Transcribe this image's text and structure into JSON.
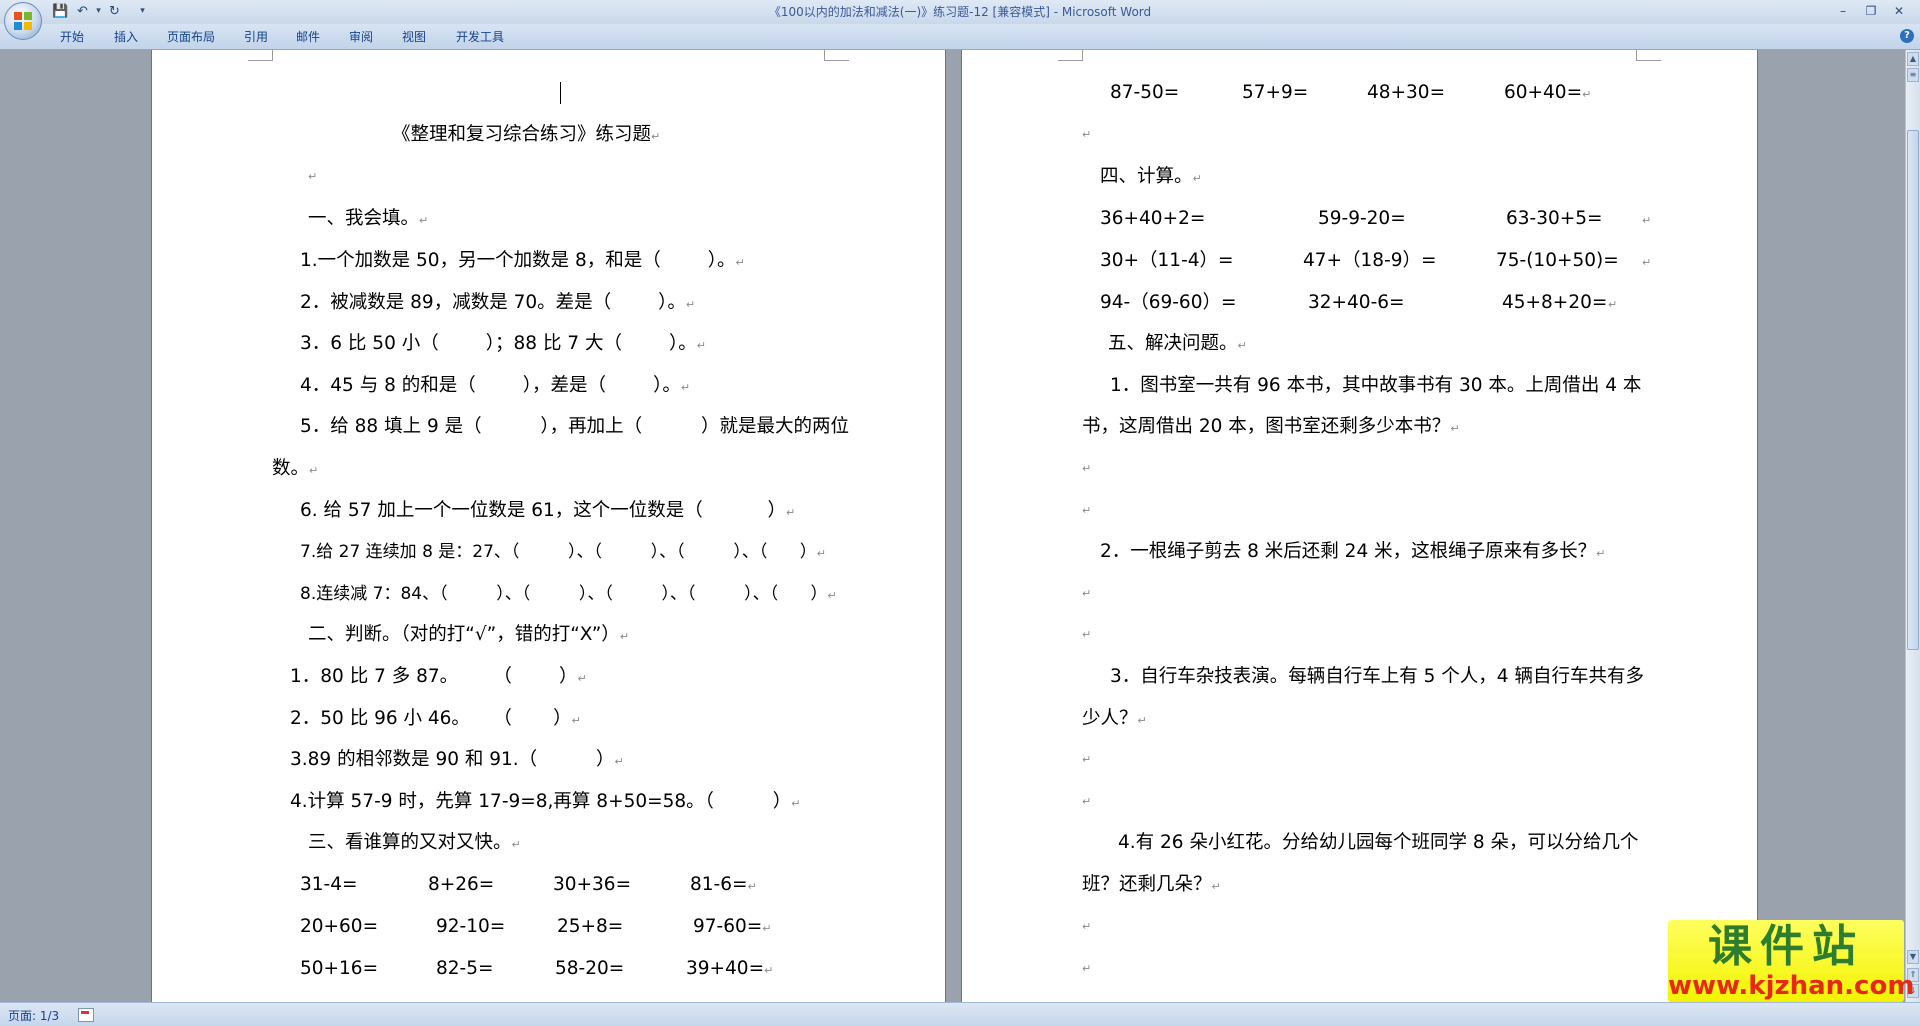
{
  "window": {
    "title": "《100以内的加法和减法(一)》练习题-12 [兼容模式] - Microsoft Word"
  },
  "quick_access": {
    "save_icon": "save-icon",
    "undo_icon": "undo-icon",
    "redo_icon": "redo-icon",
    "customize": "▾"
  },
  "ribbon": {
    "tabs": [
      "开始",
      "插入",
      "页面布局",
      "引用",
      "邮件",
      "审阅",
      "视图",
      "开发工具"
    ]
  },
  "page1": {
    "title": "《整理和复习综合练习》练习题",
    "lines": [
      "一、我会填。",
      "1.一个加数是 50，另一个加数是 8，和是（        ）。",
      "2．被减数是 89，减数是 70。差是（        ）。",
      "3．6 比 50 小（        ）；88 比 7 大（        ）。",
      "4．45 与 8 的和是（        ），差是（        ）。",
      "5．给 88 填上 9 是（          ），再加上（          ）就是最大的两位",
      "数。",
      "6. 给 57 加上一个一位数是 61，这个一位数是（           ）",
      "7.给 27 连续加 8 是：27、（         ）、（         ）、（         ）、（      ）",
      "8.连续减 7：84、（         ）、（         ）、（         ）、（         ）、（      ）",
      "二、判断。（对的打“√”，错的打“X”）",
      "1．80 比 7 多 87。      （        ）",
      "2．50 比 96 小 46。    （       ）",
      "3.89 的相邻数是 90 和 91.（          ）",
      "4.计算 57-9 时，先算 17-9=8,再算 8+50=58。（          ）",
      "三、看谁算的又对又快。"
    ],
    "calc_rows": [
      [
        "31-4=",
        "8+26=",
        "30+36=",
        "81-6="
      ],
      [
        "20+60=",
        "92-10=",
        "25+8=",
        "97-60="
      ],
      [
        "50+16=",
        "82-5=",
        "58-20=",
        "39+40="
      ]
    ]
  },
  "page2": {
    "calc_row": [
      "87-50=",
      "57+9=",
      "48+30=",
      "60+40="
    ],
    "section4_title": "四、计算。",
    "section4_rows": [
      [
        "36+40+2=",
        "59-9-20=",
        "63-30+5="
      ],
      [
        "30+（11-4）=",
        "47+（18-9）=",
        "75-(10+50)="
      ],
      [
        "94-（69-60）=",
        "32+40-6=",
        "45+8+20="
      ]
    ],
    "section5_title": "五、解决问题。",
    "problems": [
      "1．图书室一共有 96 本书，其中故事书有 30 本。上周借出 4 本",
      "书，这周借出 20 本，图书室还剩多少本书？",
      "2．一根绳子剪去 8 米后还剩 24 米，这根绳子原来有多长？",
      "3．自行车杂技表演。每辆自行车上有 5 个人，4 辆自行车共有多",
      "少人？",
      "4.有 26 朵小红花。分给幼儿园每个班同学 8 朵，可以分给几个",
      "班？还剩几朵？"
    ]
  },
  "paragraph_mark": "↵",
  "statusbar": {
    "page": "页面: 1/3"
  },
  "watermark": {
    "cn": "课件站",
    "url": "www.kjzhan.com"
  }
}
